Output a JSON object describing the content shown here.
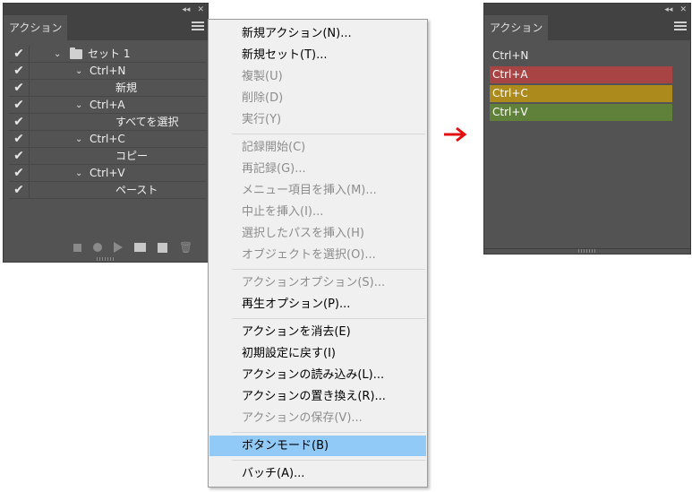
{
  "left_panel": {
    "tab_label": "アクション",
    "rows": [
      {
        "label": "セット 1",
        "kind": "set"
      },
      {
        "label": "Ctrl+N",
        "kind": "action"
      },
      {
        "label": "新規",
        "kind": "command"
      },
      {
        "label": "Ctrl+A",
        "kind": "action"
      },
      {
        "label": "すべてを選択",
        "kind": "command"
      },
      {
        "label": "Ctrl+C",
        "kind": "action"
      },
      {
        "label": "コピー",
        "kind": "command"
      },
      {
        "label": "Ctrl+V",
        "kind": "action"
      },
      {
        "label": "ペースト",
        "kind": "command"
      }
    ]
  },
  "context_menu": {
    "items": [
      {
        "label": "新規アクション(N)...",
        "enabled": true
      },
      {
        "label": "新規セット(T)...",
        "enabled": true
      },
      {
        "label": "複製(U)",
        "enabled": false
      },
      {
        "label": "削除(D)",
        "enabled": false
      },
      {
        "label": "実行(Y)",
        "enabled": false
      },
      {
        "label": "記録開始(C)",
        "enabled": false
      },
      {
        "label": "再記録(G)...",
        "enabled": false
      },
      {
        "label": "メニュー項目を挿入(M)...",
        "enabled": false
      },
      {
        "label": "中止を挿入(I)...",
        "enabled": false
      },
      {
        "label": "選択したパスを挿入(H)",
        "enabled": false
      },
      {
        "label": "オブジェクトを選択(O)...",
        "enabled": false
      },
      {
        "label": "アクションオプション(S)...",
        "enabled": false
      },
      {
        "label": "再生オプション(P)...",
        "enabled": true
      },
      {
        "label": "アクションを消去(E)",
        "enabled": true
      },
      {
        "label": "初期設定に戻す(I)",
        "enabled": true
      },
      {
        "label": "アクションの読み込み(L)...",
        "enabled": true
      },
      {
        "label": "アクションの置き換え(R)...",
        "enabled": true
      },
      {
        "label": "アクションの保存(V)...",
        "enabled": false
      },
      {
        "label": "ボタンモード(B)",
        "enabled": true,
        "selected": true
      },
      {
        "label": "バッチ(A)...",
        "enabled": true
      }
    ]
  },
  "right_panel": {
    "tab_label": "アクション",
    "buttons": [
      {
        "label": "Ctrl+N",
        "color": "none"
      },
      {
        "label": "Ctrl+A",
        "color": "#a94444"
      },
      {
        "label": "Ctrl+C",
        "color": "#ad8a1c"
      },
      {
        "label": "Ctrl+V",
        "color": "#5f8139"
      }
    ]
  },
  "colors": {
    "panel_bg": "#535353",
    "menu_highlight": "#91c9f7",
    "arrow": "#e01010"
  },
  "icons": [
    "collapse-icon",
    "close-icon",
    "panel-menu-icon",
    "checkmark-icon",
    "chevron-down-icon",
    "folder-icon",
    "stop-icon",
    "record-icon",
    "play-icon",
    "new-set-icon",
    "new-action-icon",
    "trash-icon",
    "right-arrow-icon"
  ]
}
